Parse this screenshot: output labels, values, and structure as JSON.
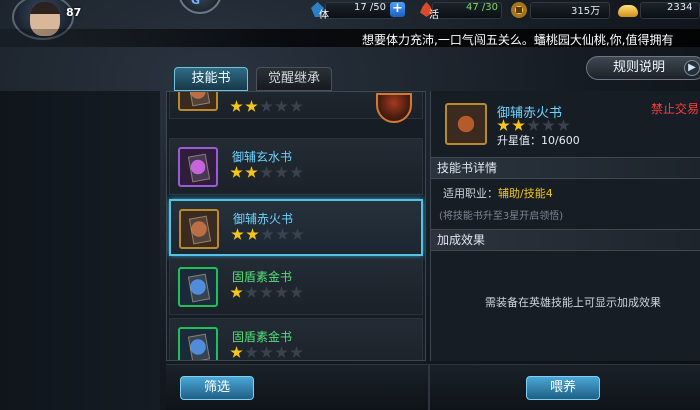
{
  "player": {
    "level": "87"
  },
  "resources": {
    "stamina_icon_label": "体",
    "stamina": "17 /50",
    "add_label": "+",
    "vitality_icon_label": "活",
    "vitality": "47 /30",
    "gold": "315万",
    "ingots": "2334"
  },
  "marquee": "想要体力充沛,一口气闯五关么。蟠桃园大仙桃,你,值得拥有",
  "tabs": [
    {
      "label": "技能书",
      "active": true
    },
    {
      "label": "觉醒继承",
      "active": false
    }
  ],
  "rules_button": "规则说明",
  "books": [
    {
      "name": "",
      "stars": 2,
      "max_stars": 5,
      "rarity": "orange",
      "name_color": "blue"
    },
    {
      "name": "御辅玄水书",
      "stars": 2,
      "max_stars": 5,
      "rarity": "purple",
      "name_color": "blue"
    },
    {
      "name": "御辅赤火书",
      "stars": 2,
      "max_stars": 5,
      "rarity": "orange",
      "name_color": "blue",
      "selected": true
    },
    {
      "name": "固盾素金书",
      "stars": 1,
      "max_stars": 5,
      "rarity": "green",
      "name_color": "green"
    },
    {
      "name": "固盾素金书",
      "stars": 1,
      "max_stars": 5,
      "rarity": "green",
      "name_color": "green"
    }
  ],
  "detail": {
    "name": "御辅赤火书",
    "stars": 2,
    "max_stars": 5,
    "progress_label": "升星值：10/600",
    "trade_status": "禁止交易",
    "section_details": "技能书详情",
    "job_label": "适用职业：",
    "job_value": "辅助/技能4",
    "hint": "(将技能书升至3星开启领悟)",
    "section_bonus": "加成效果",
    "bonus_empty": "需装备在英雄技能上可显示加成效果"
  },
  "buttons": {
    "filter": "筛选",
    "feed": "喂养"
  },
  "colors": {
    "accent": "#58c2e0",
    "star_on": "#f5c518",
    "trade_forbidden": "#ff3b3b",
    "name_blue": "#6fd3ff",
    "name_green": "#54e07a"
  }
}
